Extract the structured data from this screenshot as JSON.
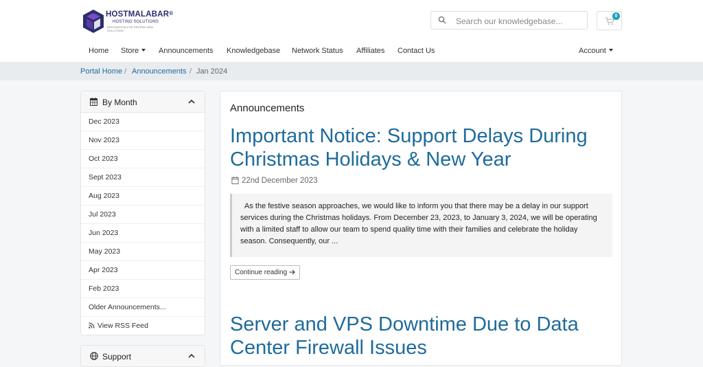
{
  "logo": {
    "brand": "HOSTMALABAR",
    "reg": "®",
    "subtitle": "HOSTING SOLUTIONS",
    "tagline": "DESTINATION FOR PROPER WEB SOLUTIONS",
    "colors": {
      "primary": "#2b2e6e",
      "accent": "#7b4cc2"
    }
  },
  "search": {
    "placeholder": "Search our knowledgebase...",
    "icon": "search-icon"
  },
  "cart": {
    "count": "0",
    "icon": "cart-icon",
    "badge_color": "#17a2b8"
  },
  "nav": {
    "items": [
      "Home",
      "Store",
      "Announcements",
      "Knowledgebase",
      "Network Status",
      "Affiliates",
      "Contact Us"
    ],
    "account": "Account"
  },
  "breadcrumb": {
    "items": [
      "Portal Home",
      "Announcements",
      "Jan 2024"
    ]
  },
  "sidebar": {
    "by_month": {
      "title": "By Month",
      "icon": "calendar-icon",
      "items": [
        "Dec 2023",
        "Nov 2023",
        "Oct 2023",
        "Sept 2023",
        "Aug 2023",
        "Jul 2023",
        "Jun 2023",
        "May 2023",
        "Apr 2023",
        "Feb 2023",
        "Older Announcements..."
      ],
      "rss": "View RSS Feed"
    },
    "support": {
      "title": "Support",
      "icon": "globe-icon"
    }
  },
  "main": {
    "title": "Announcements",
    "articles": [
      {
        "title": "Important Notice: Support Delays During Christmas Holidays & New Year",
        "date": "22nd December 2023",
        "excerpt": "As the festive season approaches, we would like to inform you that there may be a delay in our support services during the Christmas holidays. From December 23, 2023, to January 3, 2024, we will be operating with a limited staff to allow our team to spend quality time with their families and celebrate the holiday season. Consequently, our ...",
        "continue": "Continue reading"
      },
      {
        "title": "Server and VPS Downtime Due to Data Center Firewall Issues"
      }
    ]
  },
  "colors": {
    "link": "#1e6b9a",
    "background": "#f5f6f7"
  }
}
